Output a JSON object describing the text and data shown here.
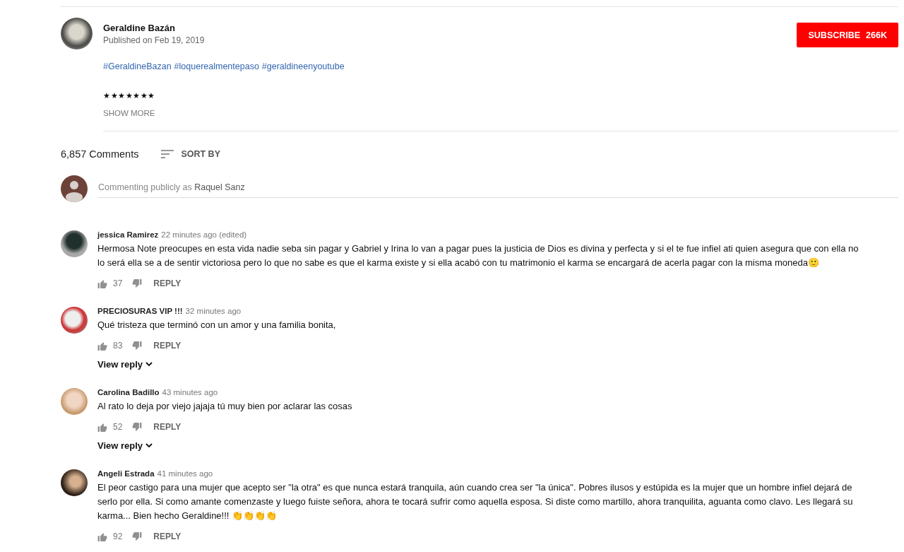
{
  "channel": {
    "name": "Geraldine Bazán",
    "published": "Published on Feb 19, 2019",
    "subscribe_label": "SUBSCRIBE",
    "subscriber_count": "266K"
  },
  "description": {
    "hashtags": [
      "#GeraldineBazan",
      "#loquerealmentepaso",
      "#geraldineenyoutube"
    ],
    "stars_line": "★★★★★★★",
    "show_more": "SHOW MORE"
  },
  "comments_header": {
    "count": "6,857 Comments",
    "sort_label": "SORT BY"
  },
  "comment_box": {
    "placeholder_prefix": "Commenting publicly as",
    "user": "Raquel Sanz"
  },
  "comments": [
    {
      "author": "jessica Ramirez",
      "time": "22 minutes ago (edited)",
      "text": "Hermosa Note preocupes en esta vida nadie seba sin pagar y Gabriel y Irina lo van a pagar pues la justicia de Dios es divina y perfecta y si el te fue infiel ati quien asegura que con ella no lo será  ella  se a de sentir victoriosa pero lo que no sabe es que  el karma existe y si ella acabó con tu matrimonio el karma se encargará de acerla pagar con la misma moneda🙂",
      "likes": "37",
      "reply_label": "REPLY"
    },
    {
      "author": "PRECIOSURAS VIP !!!",
      "time": "32 minutes ago",
      "text": "Qué tristeza que terminó con un amor y una familia bonita,",
      "likes": "83",
      "reply_label": "REPLY",
      "view_replies": "View reply"
    },
    {
      "author": "Carolina Badillo",
      "time": "43 minutes ago",
      "text": "Al rato lo deja por viejo jajaja tú muy bien por aclarar las cosas",
      "likes": "52",
      "reply_label": "REPLY",
      "view_replies": "View reply"
    },
    {
      "author": "Angeli Estrada",
      "time": "41 minutes ago",
      "text": "El peor castigo para una mujer que acepto ser \"la otra\" es que nunca estará tranquila, aún cuando crea ser \"la única\". Pobres ilusos y estúpida es la mujer que un hombre infiel dejará de serlo por ella. Si como amante comenzaste y luego fuiste señora, ahora te tocará sufrir como aquella esposa. Si diste como martillo, ahora tranquilita, aguanta como clavo. Les llegará su karma... Bien hecho Geraldine!!! 👏👏👏👏",
      "likes": "92",
      "reply_label": "REPLY"
    }
  ]
}
